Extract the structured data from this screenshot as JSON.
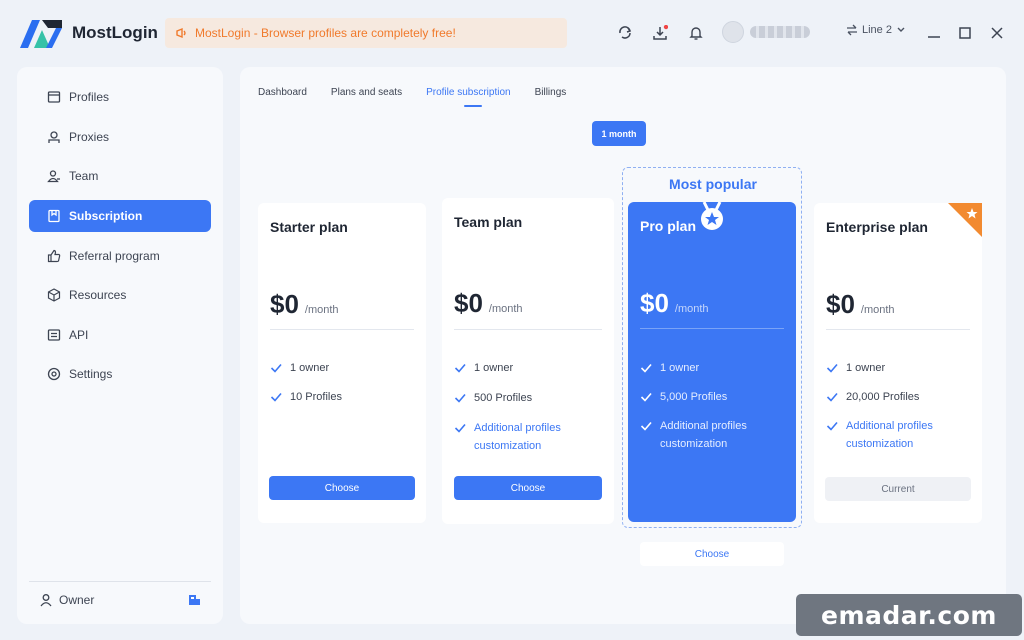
{
  "app": {
    "name": "MostLogin",
    "notice": "MostLogin - Browser profiles are completely free!",
    "line": "Line 2",
    "accent": "#3c77f4",
    "highlight": "#f07a2c"
  },
  "sidebar": {
    "items": [
      {
        "label": "Profiles",
        "icon": "profile-window-icon"
      },
      {
        "label": "Proxies",
        "icon": "proxy-icon"
      },
      {
        "label": "Team",
        "icon": "team-icon"
      },
      {
        "label": "Subscription",
        "icon": "subscription-icon"
      },
      {
        "label": "Referral program",
        "icon": "thumbs-up-icon"
      },
      {
        "label": "Resources",
        "icon": "cube-icon"
      },
      {
        "label": "API",
        "icon": "api-icon"
      },
      {
        "label": "Settings",
        "icon": "gear-icon"
      }
    ],
    "owner": "Owner"
  },
  "tabs": [
    "Dashboard",
    "Plans and seats",
    "Profile subscription",
    "Billings"
  ],
  "period": "1 month",
  "popular_label": "Most popular",
  "plans": [
    {
      "title": "Starter plan",
      "price": "$0",
      "per": "/month",
      "features": [
        "1 owner",
        "10 Profiles"
      ],
      "button": "Choose"
    },
    {
      "title": "Team plan",
      "price": "$0",
      "per": "/month",
      "features": [
        "1 owner",
        "500 Profiles",
        "Additional profiles customization"
      ],
      "button": "Choose"
    },
    {
      "title": "Pro plan",
      "price": "$0",
      "per": "/month",
      "features": [
        "1 owner",
        "5,000 Profiles",
        "Additional profiles customization"
      ],
      "button": "Choose"
    },
    {
      "title": "Enterprise plan",
      "price": "$0",
      "per": "/month",
      "features": [
        "1 owner",
        "20,000 Profiles",
        "Additional profiles customization"
      ],
      "button": "Current"
    }
  ],
  "watermark": "emadar.com"
}
